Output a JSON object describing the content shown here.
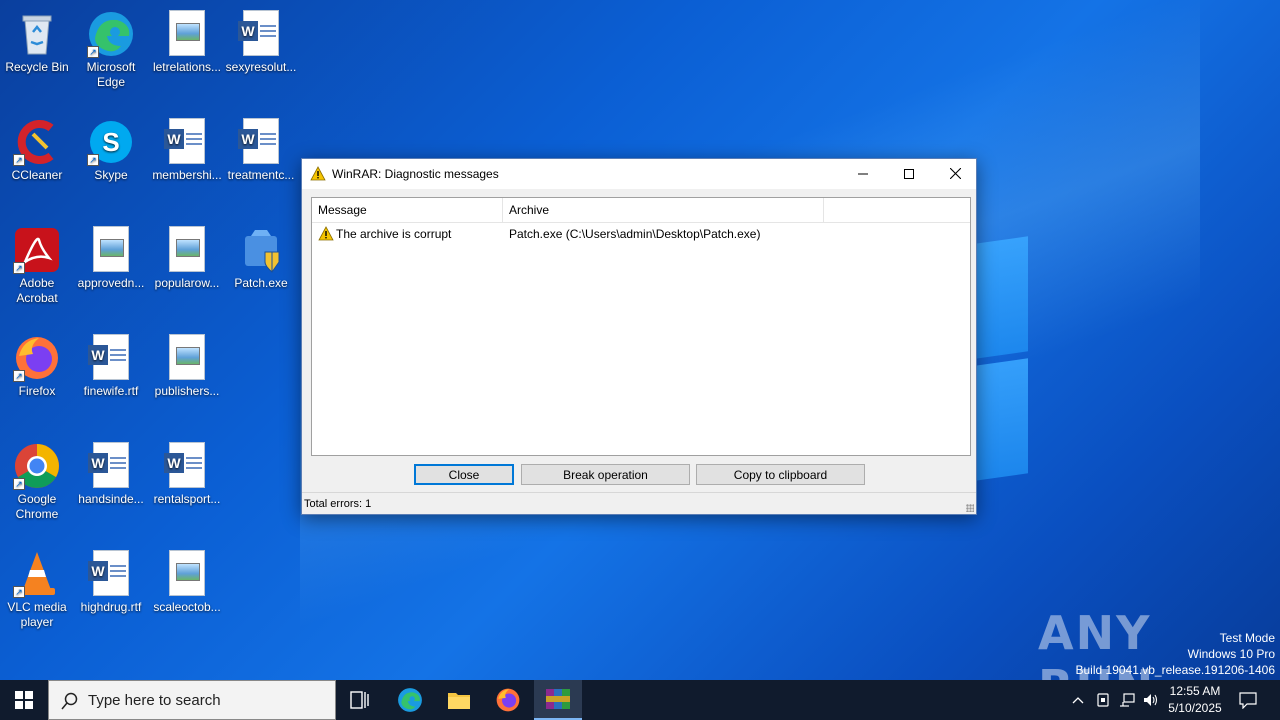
{
  "desktop": {
    "icons": [
      {
        "label": "Recycle Bin",
        "icon": "recycle-bin-icon"
      },
      {
        "label": "Microsoft Edge",
        "icon": "edge-icon"
      },
      {
        "label": "letrelations...",
        "icon": "image-file-icon"
      },
      {
        "label": "sexyresolut...",
        "icon": "word-doc-icon"
      },
      {
        "label": "CCleaner",
        "icon": "ccleaner-icon"
      },
      {
        "label": "Skype",
        "icon": "skype-icon"
      },
      {
        "label": "membershi...",
        "icon": "word-doc-icon"
      },
      {
        "label": "treatmentc...",
        "icon": "word-doc-icon"
      },
      {
        "label": "Adobe Acrobat",
        "icon": "acrobat-icon"
      },
      {
        "label": "approvedn...",
        "icon": "image-file-icon"
      },
      {
        "label": "popularow...",
        "icon": "image-file-icon"
      },
      {
        "label": "Patch.exe",
        "icon": "setup-exe-icon"
      },
      {
        "label": "Firefox",
        "icon": "firefox-icon"
      },
      {
        "label": "finewife.rtf",
        "icon": "word-doc-icon"
      },
      {
        "label": "publishers...",
        "icon": "image-file-icon"
      },
      {
        "label": "Google Chrome",
        "icon": "chrome-icon"
      },
      {
        "label": "handsinde...",
        "icon": "word-doc-icon"
      },
      {
        "label": "rentalsport...",
        "icon": "word-doc-icon"
      },
      {
        "label": "VLC media player",
        "icon": "vlc-icon"
      },
      {
        "label": "highdrug.rtf",
        "icon": "word-doc-icon"
      },
      {
        "label": "scaleoctob...",
        "icon": "image-file-icon"
      }
    ]
  },
  "dialog": {
    "title": "WinRAR: Diagnostic messages",
    "columns": [
      "Message",
      "Archive",
      ""
    ],
    "rows": [
      {
        "message": "The archive is corrupt",
        "archive": "Patch.exe (C:\\Users\\admin\\Desktop\\Patch.exe)"
      }
    ],
    "buttons": {
      "close": "Close",
      "break": "Break operation",
      "copy": "Copy to clipboard"
    },
    "status": "Total errors: 1"
  },
  "watermark": {
    "brand": "ANY RUN",
    "line1": "Test Mode",
    "line2": "Windows 10 Pro",
    "line3": "Build 19041.vb_release.191206-1406"
  },
  "taskbar": {
    "search_placeholder": "Type here to search",
    "time": "12:55 AM",
    "date": "5/10/2025"
  },
  "colors": {
    "accent": "#0078d7",
    "taskbar": "#101b2d",
    "warning": "#f5c400"
  }
}
